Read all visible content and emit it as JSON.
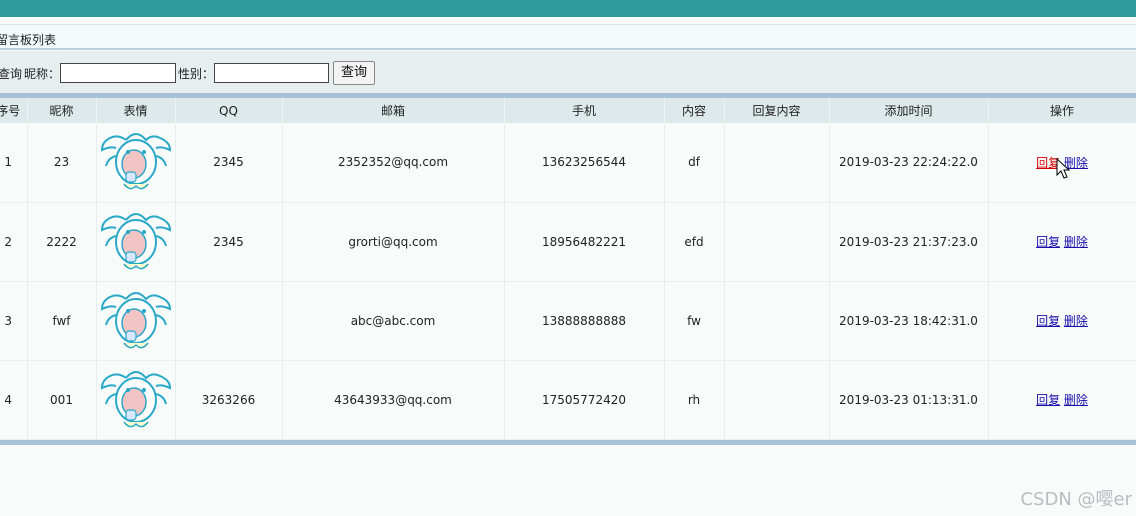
{
  "breadcrumb": "留言板列表",
  "search": {
    "query_label": "查询",
    "nickname_label": "昵称：",
    "nickname_value": "",
    "gender_label": "性别：",
    "gender_value": "",
    "button_label": "查询"
  },
  "table": {
    "headers": [
      "序号",
      "昵称",
      "表情",
      "QQ",
      "邮箱",
      "手机",
      "内容",
      "回复内容",
      "添加时间",
      "操作"
    ],
    "rows": [
      {
        "no": "1",
        "nickname": "23",
        "face": "cartoon-face-icon",
        "qq": "2345",
        "email": "2352352@qq.com",
        "phone": "13623256544",
        "content": "df",
        "reply": "",
        "time": "2019-03-23 22:24:22.0",
        "reply_link": "回复",
        "delete_link": "删除"
      },
      {
        "no": "2",
        "nickname": "2222",
        "face": "cartoon-face-icon",
        "qq": "2345",
        "email": "grorti@qq.com",
        "phone": "18956482221",
        "content": "efd",
        "reply": "",
        "time": "2019-03-23 21:37:23.0",
        "reply_link": "回复",
        "delete_link": "删除"
      },
      {
        "no": "3",
        "nickname": "fwf",
        "face": "cartoon-face-icon",
        "qq": "",
        "email": "abc@abc.com",
        "phone": "13888888888",
        "content": "fw",
        "reply": "",
        "time": "2019-03-23 18:42:31.0",
        "reply_link": "回复",
        "delete_link": "删除"
      },
      {
        "no": "4",
        "nickname": "001",
        "face": "cartoon-face-icon",
        "qq": "3263266",
        "email": "43643933@qq.com",
        "phone": "17505772420",
        "content": "rh",
        "reply": "",
        "time": "2019-03-23 01:13:31.0",
        "reply_link": "回复",
        "delete_link": "删除"
      }
    ]
  },
  "watermark": "CSDN @嘤er",
  "colors": {
    "topbar": "#2f9a9a",
    "link": "#1a0dab",
    "link_active": "#d40000",
    "table_border": "#a9c1d6"
  }
}
